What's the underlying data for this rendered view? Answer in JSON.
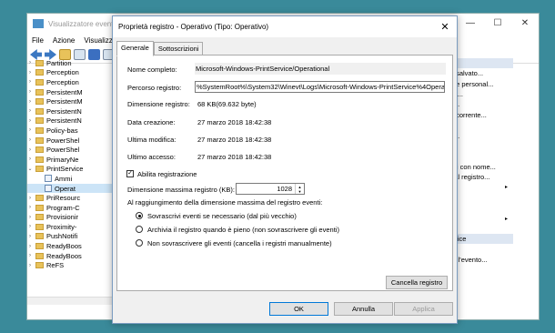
{
  "background_window": {
    "title": "Visualizzatore eventi",
    "window_controls": {
      "minimize": "—",
      "maximize": "☐",
      "close": "✕"
    },
    "menu": [
      "File",
      "Azione",
      "Visualizza"
    ],
    "tree": [
      {
        "label": "Partition",
        "arrow": "›",
        "type": "folder"
      },
      {
        "label": "Perception",
        "arrow": "›",
        "type": "folder"
      },
      {
        "label": "Perception",
        "arrow": "›",
        "type": "folder"
      },
      {
        "label": "PersistentM",
        "arrow": "›",
        "type": "folder"
      },
      {
        "label": "PersistentM",
        "arrow": "›",
        "type": "folder"
      },
      {
        "label": "PersistentN",
        "arrow": "›",
        "type": "folder"
      },
      {
        "label": "PersistentN",
        "arrow": "›",
        "type": "folder"
      },
      {
        "label": "Policy-bas",
        "arrow": "›",
        "type": "folder"
      },
      {
        "label": "PowerShel",
        "arrow": "›",
        "type": "folder"
      },
      {
        "label": "PowerShel",
        "arrow": "›",
        "type": "folder"
      },
      {
        "label": "PrimaryNe",
        "arrow": "›",
        "type": "folder"
      },
      {
        "label": "PrintService",
        "arrow": "⌄",
        "type": "folder"
      },
      {
        "label": "Ammi",
        "arrow": "",
        "type": "log",
        "indent": true
      },
      {
        "label": "Operat",
        "arrow": "",
        "type": "log",
        "indent": true,
        "selected": true
      },
      {
        "label": "PriResourc",
        "arrow": "›",
        "type": "folder"
      },
      {
        "label": "Program-C",
        "arrow": "›",
        "type": "folder"
      },
      {
        "label": "Provisionir",
        "arrow": "›",
        "type": "folder"
      },
      {
        "label": "Proximity-",
        "arrow": "›",
        "type": "folder"
      },
      {
        "label": "PushNotifi",
        "arrow": "›",
        "type": "folder"
      },
      {
        "label": "ReadyBoos",
        "arrow": "›",
        "type": "folder"
      },
      {
        "label": "ReadyBoos",
        "arrow": "›",
        "type": "folder"
      },
      {
        "label": "ReFS",
        "arrow": "›",
        "type": "folder"
      }
    ],
    "actions": [
      {
        "label": "",
        "type": "head"
      },
      {
        "label": "registro salvato...",
        "type": "item"
      },
      {
        "label": "izzazione personal...",
        "type": "item"
      },
      {
        "label": "i registro...",
        "type": "item"
      },
      {
        "label": "registro...",
        "type": "item"
      },
      {
        "label": "registro corrente...",
        "type": "item"
      },
      {
        "label": "",
        "type": "item"
      },
      {
        "label": "registro...",
        "type": "item"
      },
      {
        "label": "",
        "type": "item"
      },
      {
        "label": "",
        "type": "item"
      },
      {
        "label": "gli eventi con nome...",
        "type": "item"
      },
      {
        "label": "'attività al registro...",
        "type": "item"
      },
      {
        "label": "",
        "type": "item",
        "arrow": "▸"
      },
      {
        "label": "",
        "type": "item"
      },
      {
        "label": "",
        "type": "item"
      },
      {
        "label": "",
        "type": "item",
        "arrow": "▸"
      },
      {
        "label": "",
        "type": "item"
      },
      {
        "label": "rintService",
        "type": "head"
      },
      {
        "label": "tutto",
        "type": "item"
      },
      {
        "label": "attività all'evento...",
        "type": "item"
      }
    ]
  },
  "dialog": {
    "title": "Proprietà registro - Operativo (Tipo: Operativo)",
    "close": "✕",
    "tabs": [
      "Generale",
      "Sottoscrizioni"
    ],
    "fields": {
      "full_name_label": "Nome completo:",
      "full_name_value": "Microsoft-Windows-PrintService/Operational",
      "path_label": "Percorso registro:",
      "path_value": "%SystemRoot%\\System32\\Winevt\\Logs\\Microsoft-Windows-PrintService%4Operational.evtx",
      "size_label": "Dimensione registro:",
      "size_value": "68 KB(69.632 byte)",
      "created_label": "Data creazione:",
      "created_value": "27 marzo 2018 18:42:38",
      "modified_label": "Ultima modifica:",
      "modified_value": "27 marzo 2018 18:42:38",
      "accessed_label": "Ultimo accesso:",
      "accessed_value": "27 marzo 2018 18:42:38"
    },
    "enable_logging": {
      "label": "Abilita registrazione",
      "checked": "✓"
    },
    "max_size": {
      "label": "Dimensione massima registro (KB):",
      "value": "1028",
      "up": "▲",
      "down": "▼"
    },
    "limit_heading": "Al raggiungimento della dimensione massima del registro eventi:",
    "options": [
      {
        "label": "Sovrascrivi eventi se necessario (dal più vecchio)",
        "selected": true
      },
      {
        "label": "Archivia il registro quando è pieno (non sovrascrivere gli eventi)",
        "selected": false
      },
      {
        "label": "Non sovrascrivere gli eventi (cancella i registri manualmente)",
        "selected": false
      }
    ],
    "clear_button": "Cancella registro",
    "ok_button": "OK",
    "cancel_button": "Annulla",
    "apply_button": "Applica"
  }
}
